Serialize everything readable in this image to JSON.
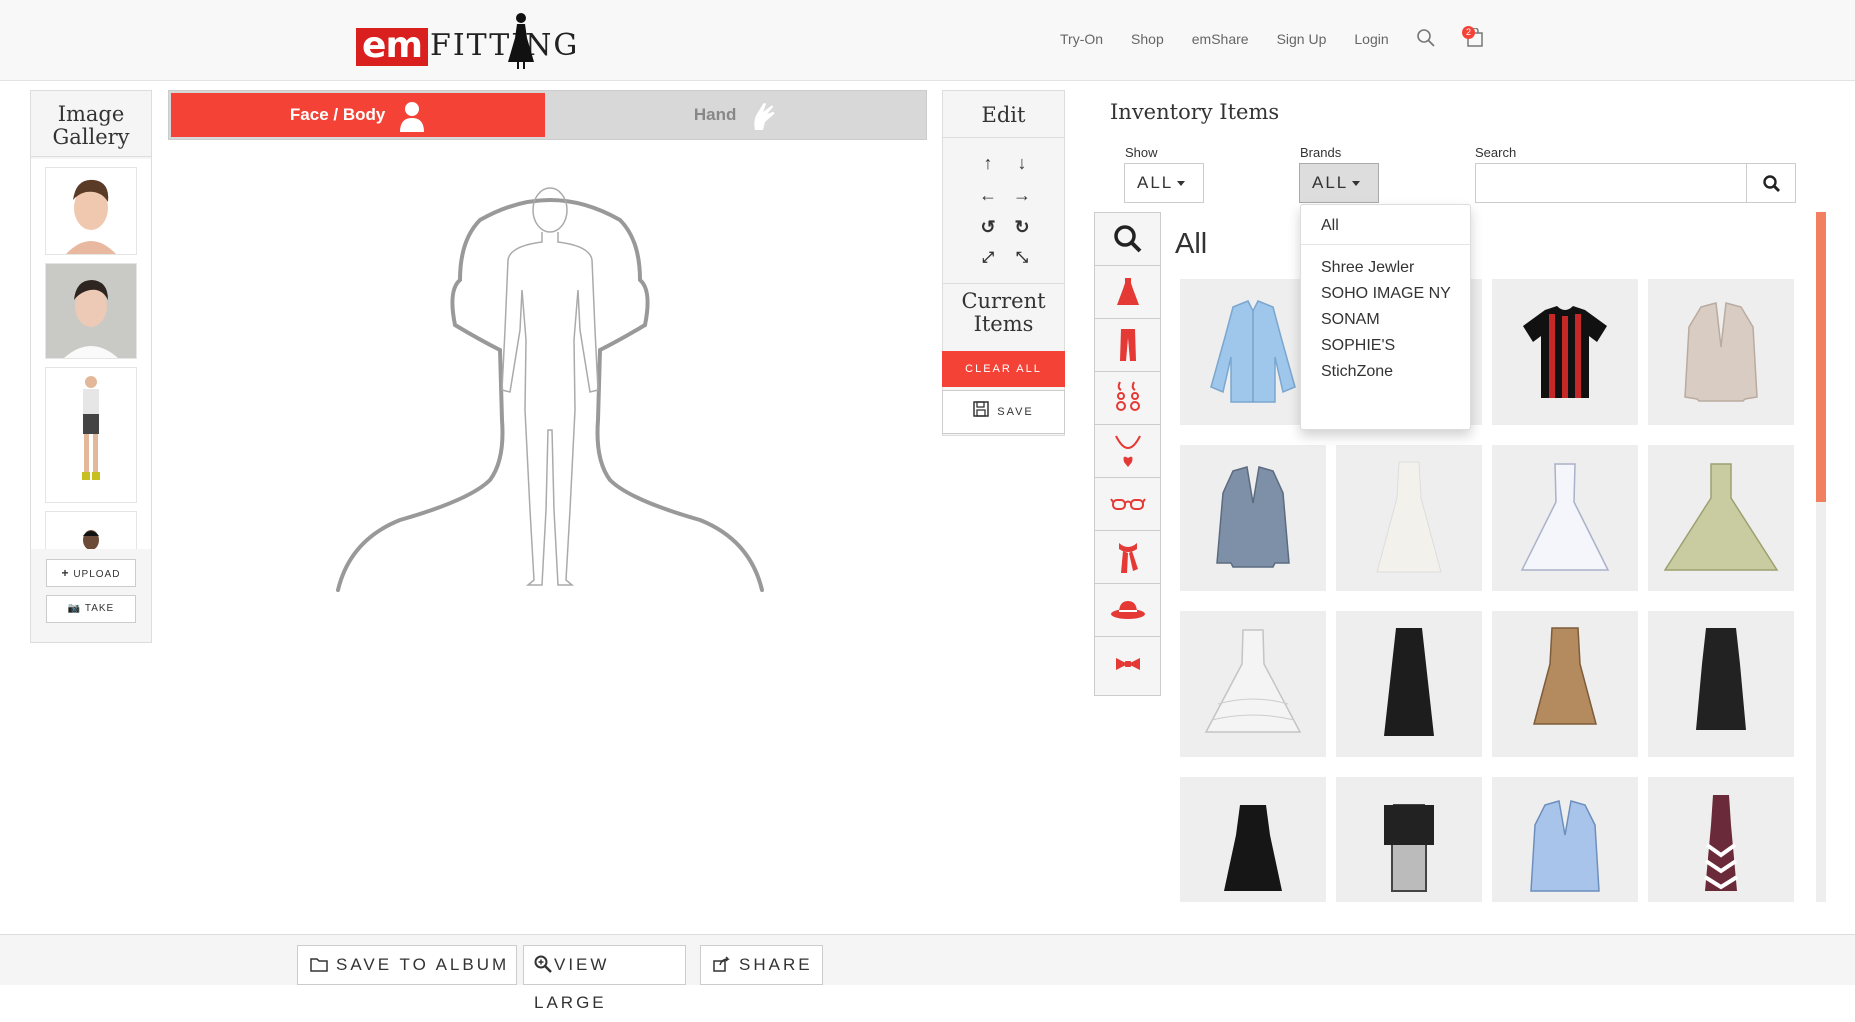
{
  "nav": {
    "logo_em": "em",
    "logo_fitting": "FITTING",
    "links": [
      "Try-On",
      "Shop",
      "emShare",
      "Sign Up",
      "Login"
    ],
    "cart_count": "2"
  },
  "gallery": {
    "title": "Image Gallery",
    "upload_label": "UPLOAD",
    "take_label": "TAKE"
  },
  "tabs": {
    "face_body": "Face / Body",
    "hand": "Hand"
  },
  "edit": {
    "title": "Edit",
    "current_items_title": "Current Items",
    "clear_all": "CLEAR ALL",
    "save": "SAVE"
  },
  "inventory": {
    "title": "Inventory Items",
    "show_label": "Show",
    "show_value": "ALL",
    "brands_label": "Brands",
    "brands_value": "ALL",
    "search_label": "Search",
    "search_value": "",
    "section_title": "All",
    "brand_options": [
      "All",
      "Shree Jewler",
      "SOHO IMAGE NY",
      "SONAM",
      "SOPHIE'S",
      "StichZone"
    ],
    "categories": [
      "search-icon",
      "dress-icon",
      "pants-icon",
      "earrings-icon",
      "necklace-icon",
      "glasses-icon",
      "scarf-icon",
      "hat-icon",
      "bowtie-icon"
    ]
  },
  "bottom": {
    "save_album": "SAVE TO ALBUM",
    "view_large": "VIEW LARGE",
    "share": "SHARE"
  },
  "colors": {
    "accent": "#f44336",
    "scroll": "#f08060"
  }
}
